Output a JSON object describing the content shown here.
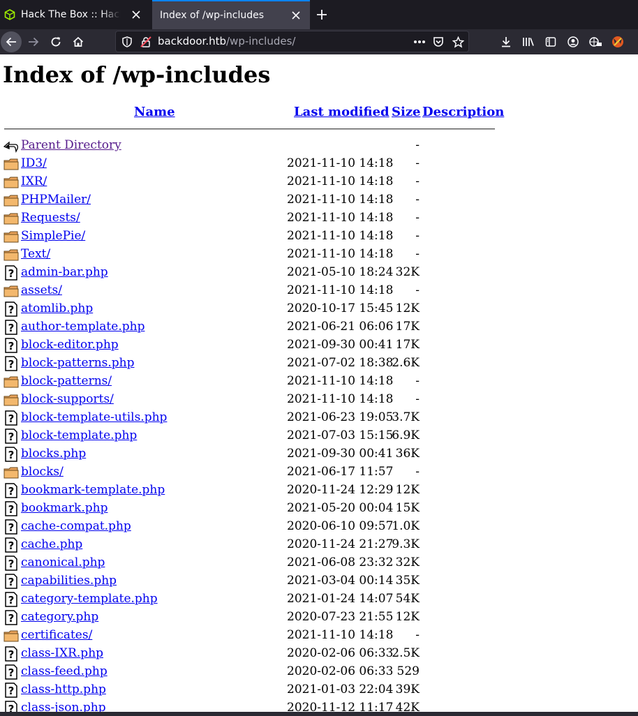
{
  "browser": {
    "tabs": [
      {
        "title": "Hack The Box :: Hack The Box",
        "active": false,
        "favicon": "hack-the-box-cube-icon"
      },
      {
        "title": "Index of /wp-includes",
        "active": true
      }
    ],
    "url": {
      "host": "backdoor.htb",
      "path": "/wp-includes/"
    },
    "colors": {
      "tabbar": "#1c1b22",
      "navbar": "#2b2a33",
      "active_tab": "#42414d",
      "accent": "#0a84ff"
    }
  },
  "page": {
    "title": "Index of /wp-includes",
    "columns": {
      "name": "Name",
      "modified": "Last modified",
      "size": "Size",
      "description": "Description"
    },
    "rows": [
      {
        "type": "parent",
        "name": "Parent Directory",
        "modified": "",
        "size": "-"
      },
      {
        "type": "dir",
        "name": "ID3/",
        "modified": "2021-11-10 14:18",
        "size": "-"
      },
      {
        "type": "dir",
        "name": "IXR/",
        "modified": "2021-11-10 14:18",
        "size": "-"
      },
      {
        "type": "dir",
        "name": "PHPMailer/",
        "modified": "2021-11-10 14:18",
        "size": "-"
      },
      {
        "type": "dir",
        "name": "Requests/",
        "modified": "2021-11-10 14:18",
        "size": "-"
      },
      {
        "type": "dir",
        "name": "SimplePie/",
        "modified": "2021-11-10 14:18",
        "size": "-"
      },
      {
        "type": "dir",
        "name": "Text/",
        "modified": "2021-11-10 14:18",
        "size": "-"
      },
      {
        "type": "file",
        "name": "admin-bar.php",
        "modified": "2021-05-10 18:24",
        "size": "32K"
      },
      {
        "type": "dir",
        "name": "assets/",
        "modified": "2021-11-10 14:18",
        "size": "-"
      },
      {
        "type": "file",
        "name": "atomlib.php",
        "modified": "2020-10-17 15:45",
        "size": "12K"
      },
      {
        "type": "file",
        "name": "author-template.php",
        "modified": "2021-06-21 06:06",
        "size": "17K"
      },
      {
        "type": "file",
        "name": "block-editor.php",
        "modified": "2021-09-30 00:41",
        "size": "17K"
      },
      {
        "type": "file",
        "name": "block-patterns.php",
        "modified": "2021-07-02 18:38",
        "size": "2.6K"
      },
      {
        "type": "dir",
        "name": "block-patterns/",
        "modified": "2021-11-10 14:18",
        "size": "-"
      },
      {
        "type": "dir",
        "name": "block-supports/",
        "modified": "2021-11-10 14:18",
        "size": "-"
      },
      {
        "type": "file",
        "name": "block-template-utils.php",
        "modified": "2021-06-23 19:05",
        "size": "3.7K"
      },
      {
        "type": "file",
        "name": "block-template.php",
        "modified": "2021-07-03 15:15",
        "size": "6.9K"
      },
      {
        "type": "file",
        "name": "blocks.php",
        "modified": "2021-09-30 00:41",
        "size": "36K"
      },
      {
        "type": "dir",
        "name": "blocks/",
        "modified": "2021-06-17 11:57",
        "size": "-"
      },
      {
        "type": "file",
        "name": "bookmark-template.php",
        "modified": "2020-11-24 12:29",
        "size": "12K"
      },
      {
        "type": "file",
        "name": "bookmark.php",
        "modified": "2021-05-20 00:04",
        "size": "15K"
      },
      {
        "type": "file",
        "name": "cache-compat.php",
        "modified": "2020-06-10 09:57",
        "size": "1.0K"
      },
      {
        "type": "file",
        "name": "cache.php",
        "modified": "2020-11-24 21:27",
        "size": "9.3K"
      },
      {
        "type": "file",
        "name": "canonical.php",
        "modified": "2021-06-08 23:32",
        "size": "32K"
      },
      {
        "type": "file",
        "name": "capabilities.php",
        "modified": "2021-03-04 00:14",
        "size": "35K"
      },
      {
        "type": "file",
        "name": "category-template.php",
        "modified": "2021-01-24 14:07",
        "size": "54K"
      },
      {
        "type": "file",
        "name": "category.php",
        "modified": "2020-07-23 21:55",
        "size": "12K"
      },
      {
        "type": "dir",
        "name": "certificates/",
        "modified": "2021-11-10 14:18",
        "size": "-"
      },
      {
        "type": "file",
        "name": "class-IXR.php",
        "modified": "2020-02-06 06:33",
        "size": "2.5K"
      },
      {
        "type": "file",
        "name": "class-feed.php",
        "modified": "2020-02-06 06:33",
        "size": "529"
      },
      {
        "type": "file",
        "name": "class-http.php",
        "modified": "2021-01-03 22:04",
        "size": "39K"
      },
      {
        "type": "file",
        "name": "class-json.php",
        "modified": "2020-11-12 11:17",
        "size": "42K"
      }
    ]
  }
}
